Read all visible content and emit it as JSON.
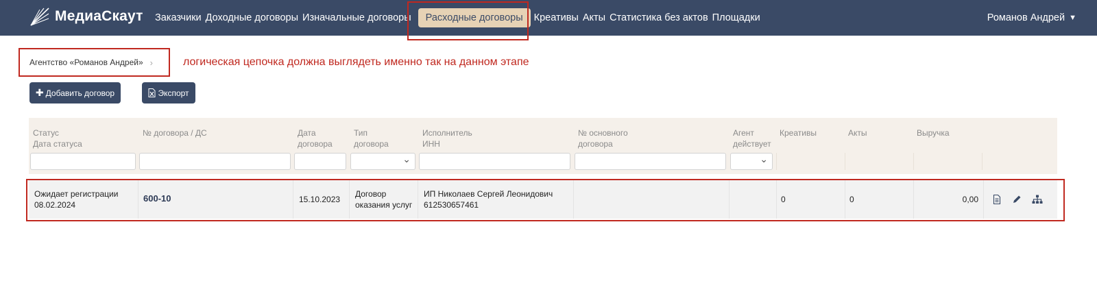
{
  "navbar": {
    "brand": "МедиаСкаут",
    "items": [
      {
        "label": "Заказчики"
      },
      {
        "label": "Доходные договоры"
      },
      {
        "label": "Изначальные договоры"
      },
      {
        "label": "Расходные договоры"
      },
      {
        "label": "Креативы"
      },
      {
        "label": "Акты"
      },
      {
        "label": "Статистика без актов"
      },
      {
        "label": "Площадки"
      }
    ],
    "user": "Романов Андрей"
  },
  "breadcrumb": {
    "item": "Агентство «Романов Андрей»",
    "separator": "›"
  },
  "note": "логическая цепочка должна выглядеть именно так на данном этапе",
  "buttons": {
    "add": "Добавить договор",
    "export": "Экспорт"
  },
  "table": {
    "headers": {
      "status": "Статус\nДата статуса",
      "number": "№ договора / ДС",
      "date": "Дата\nдоговора",
      "type": "Тип\nдоговора",
      "executor": "Исполнитель\nИНН",
      "main_number": "№ основного\nдоговора",
      "agent": "Агент\nдействует",
      "creatives": "Креативы",
      "acts": "Акты",
      "revenue": "Выручка"
    },
    "rows": [
      {
        "status": "Ожидает регистрации",
        "status_date": "08.02.2024",
        "number": "600-10",
        "date": "15.10.2023",
        "type_line1": "Договор",
        "type_line2": "оказания услуг",
        "executor": "ИП Николаев Сергей Леонидович",
        "inn": "612530657461",
        "creatives": "0",
        "acts": "0",
        "revenue": "0,00"
      }
    ]
  },
  "icons": [
    "document-icon",
    "pencil-icon",
    "hierarchy-icon"
  ],
  "colors": {
    "navbar": "#3a4a66",
    "active_tab": "#e6d2b5",
    "highlight": "#c0281f"
  }
}
